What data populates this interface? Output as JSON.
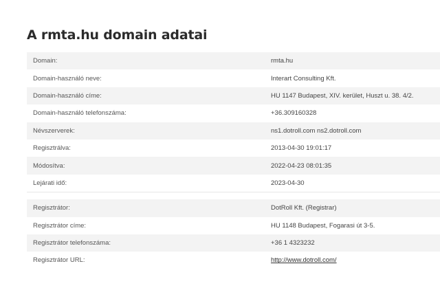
{
  "title": "A rmta.hu domain adatai",
  "domain_rows": [
    {
      "label": "Domain:",
      "value": "rmta.hu"
    },
    {
      "label": "Domain-használó neve:",
      "value": "Interart Consulting Kft."
    },
    {
      "label": "Domain-használó címe:",
      "value": "HU 1147 Budapest, XIV. kerület, Huszt u. 38. 4/2."
    },
    {
      "label": "Domain-használó telefonszáma:",
      "value": "+36.309160328"
    },
    {
      "label": "Névszerverek:",
      "value": "ns1.dotroll.com ns2.dotroll.com"
    },
    {
      "label": "Regisztrálva:",
      "value": "2013-04-30 19:01:17"
    },
    {
      "label": "Módosítva:",
      "value": "2022-04-23 08:01:35"
    },
    {
      "label": "Lejárati idő:",
      "value": "2023-04-30"
    }
  ],
  "registrar_rows": [
    {
      "label": "Regisztrátor:",
      "value": "DotRoll Kft. (Registrar)"
    },
    {
      "label": "Regisztrátor címe:",
      "value": "HU 1148 Budapest, Fogarasi út 3-5."
    },
    {
      "label": "Regisztrátor telefonszáma:",
      "value": "+36 1 4323232"
    },
    {
      "label": "Regisztrátor URL:",
      "value": "http://www.dotroll.com/"
    }
  ]
}
